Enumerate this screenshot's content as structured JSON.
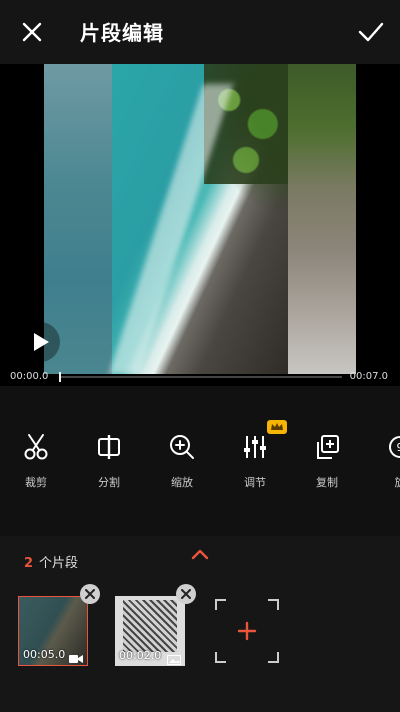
{
  "header": {
    "title": "片段编辑"
  },
  "player": {
    "time_current": "00:00.0",
    "time_total": "00:07.0",
    "progress": 0.0
  },
  "tools": [
    {
      "label": "裁剪",
      "icon": "scissors-icon"
    },
    {
      "label": "分割",
      "icon": "split-icon"
    },
    {
      "label": "缩放",
      "icon": "zoom-in-icon"
    },
    {
      "label": "调节",
      "icon": "sliders-icon",
      "badge": "crown-icon"
    },
    {
      "label": "复制",
      "icon": "copy-icon"
    },
    {
      "label": "旋",
      "icon": "rotate-icon"
    }
  ],
  "clips": {
    "count": "2",
    "count_label": "个片段",
    "items": [
      {
        "duration": "00:05.0",
        "type": "video-icon",
        "selected": true
      },
      {
        "duration": "00:02.0",
        "type": "image-icon",
        "selected": false
      }
    ]
  },
  "colors": {
    "accent": "#e8553a",
    "crown": "#f5b500"
  }
}
